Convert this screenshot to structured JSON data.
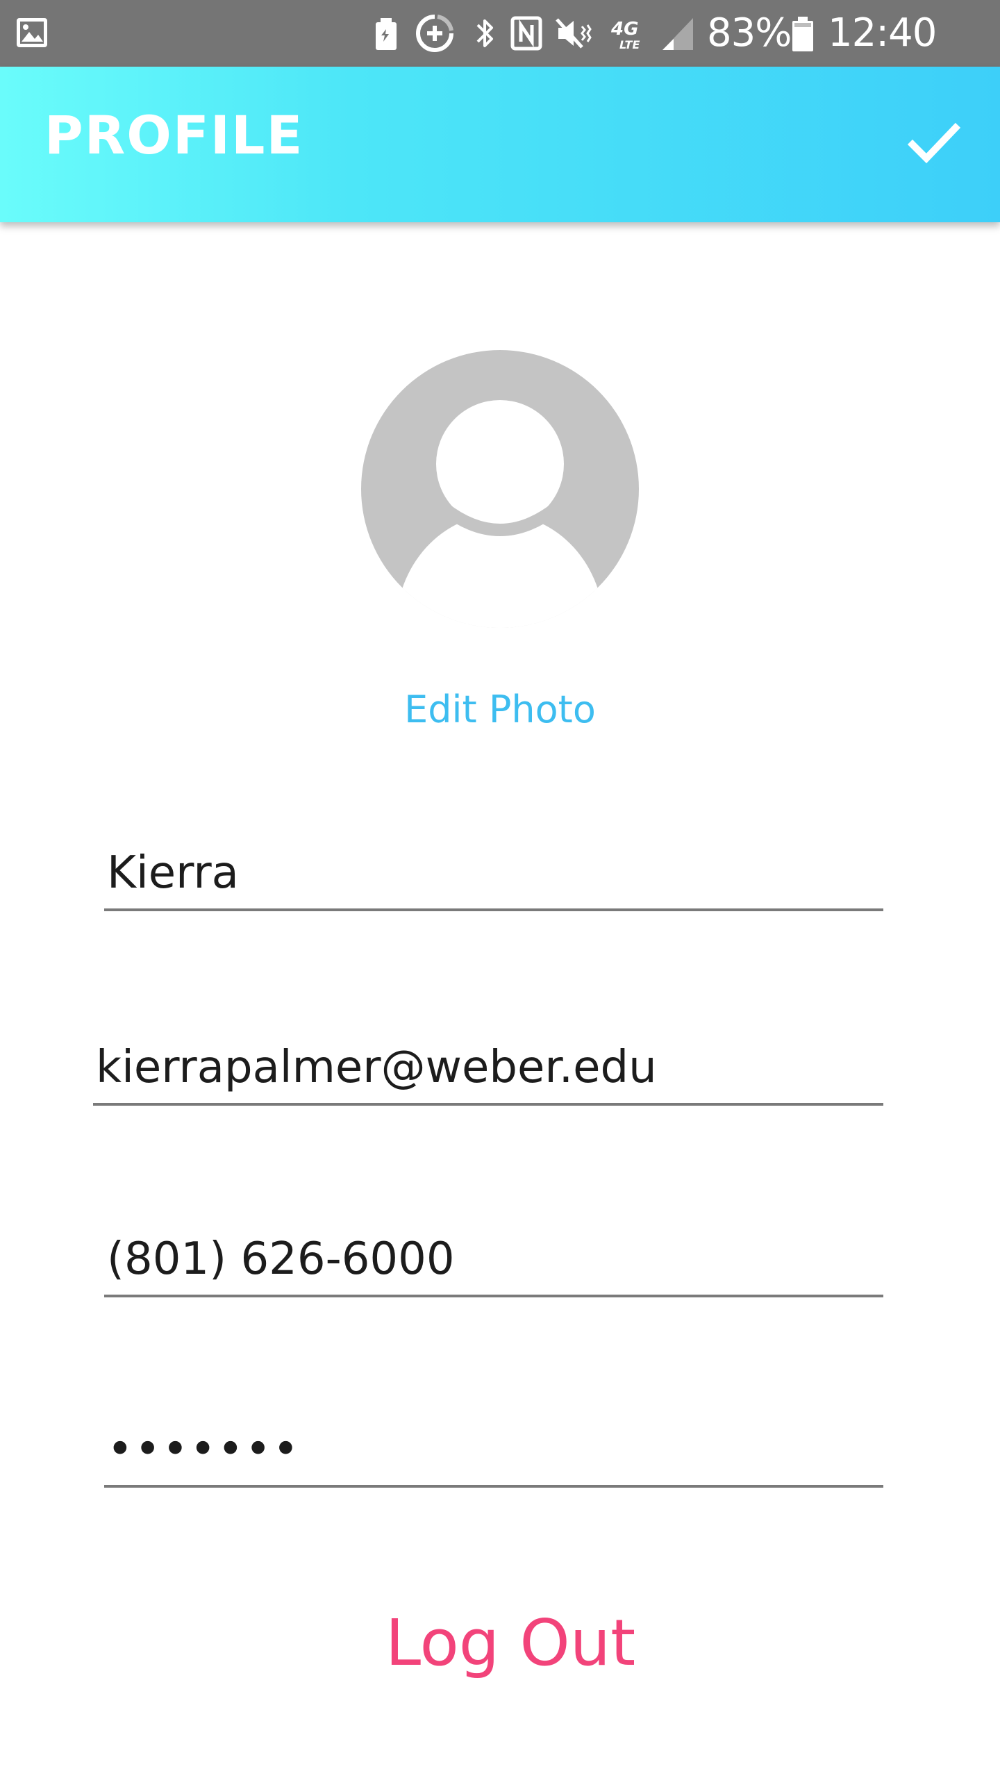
{
  "status_bar": {
    "battery_percent": "83%",
    "time": "12:40 PM",
    "network_label": "4G LTE",
    "icons": [
      "gallery-icon",
      "battery-saver-icon",
      "data-saver-icon",
      "bluetooth-icon",
      "nfc-icon",
      "mute-icon",
      "network-4g-icon",
      "signal-icon",
      "battery-icon"
    ]
  },
  "app_bar": {
    "title": "PROFILE",
    "confirm_icon": "check-icon",
    "gradient_start": "#6afcfb",
    "gradient_end": "#3dcff9"
  },
  "profile": {
    "avatar_icon": "default-avatar-icon",
    "edit_photo_label": "Edit Photo",
    "name_value": "Kierra",
    "email_value": "kierrapalmer@weber.edu",
    "phone_value": "(801) 626-6000",
    "password_value": "•••••••"
  },
  "actions": {
    "logout_label": "Log Out",
    "logout_color": "#f2437a",
    "accent_color": "#3dbdf0"
  }
}
